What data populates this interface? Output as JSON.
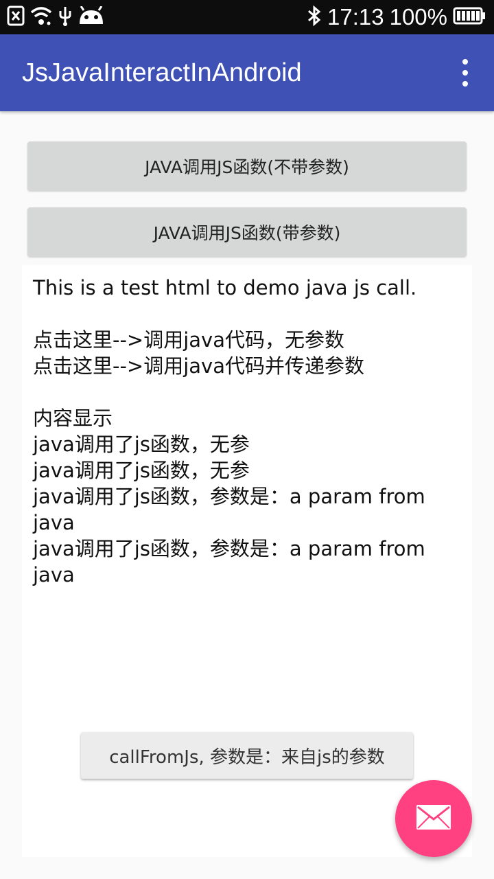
{
  "status_bar": {
    "time": "17:13",
    "battery": "100%",
    "icons": [
      "sim-off-icon",
      "wifi-icon",
      "usb-icon",
      "android-icon",
      "bluetooth-icon",
      "battery-icon"
    ]
  },
  "toolbar": {
    "title": "JsJavaInteractInAndroid",
    "menu_icon": "overflow-menu-icon",
    "background": "#3f51b5"
  },
  "buttons": {
    "call_js_no_param": "JAVA调用JS函数(不带参数)",
    "call_js_with_param": "JAVA调用JS函数(带参数)"
  },
  "webview": {
    "intro": "This is a test html to demo java js call.",
    "link_no_param": "点击这里-->调用java代码，无参数",
    "link_with_param": "点击这里-->调用java代码并传递参数",
    "content_heading": "内容显示",
    "log_lines": [
      "java调用了js函数，无参",
      "java调用了js函数，无参",
      "java调用了js函数，参数是：a param from java",
      "java调用了js函数，参数是：a param from java"
    ]
  },
  "toast": {
    "text": "callFromJs, 参数是：来自js的参数"
  },
  "fab": {
    "icon": "mail-icon",
    "color": "#ff4081"
  }
}
